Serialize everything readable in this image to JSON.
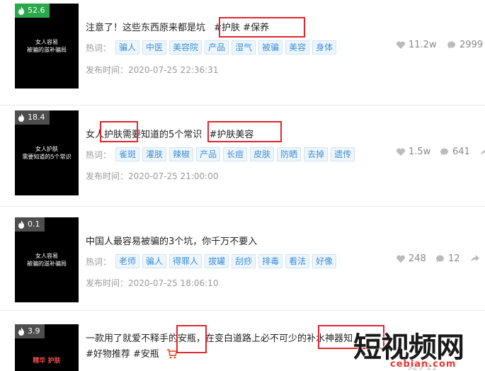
{
  "labels": {
    "hot_words": "热词："
  },
  "items": [
    {
      "heat": "52.6",
      "thumb_text": "女人容易\n被骗的滋补骗局",
      "title": "注意了！这些东西原来都是坑",
      "hashtags": "#护肤 #保养",
      "tags": [
        "骗人",
        "中医",
        "美容院",
        "产品",
        "湿气",
        "被骗",
        "美容",
        "身体"
      ],
      "time": "发布时间：2020-07-25 22:36:31",
      "likes": "11.2w",
      "comments": "2999"
    },
    {
      "heat": "18.4",
      "thumb_text": "女人护肤\n需要知道的5个常识",
      "title_a": "女人",
      "title_b": "护肤",
      "title_c": "需要知道的5个常识",
      "hashtags": "#护肤美容",
      "tags": [
        "雀斑",
        "灌肤",
        "辣椒",
        "产品",
        "长痘",
        "皮肤",
        "防晒",
        "去掉",
        "遗传"
      ],
      "time": "发布时间：2020-07-25 21:00:00",
      "likes": "1.5w",
      "comments": "641"
    },
    {
      "heat": "0.1",
      "thumb_text": "女人容易\n被骗的滋补骗局",
      "title": "中国人最容易被骗的3个坑，你千万不要入",
      "tags": [
        "老师",
        "骗人",
        "得罪人",
        "拔罐",
        "刮痧",
        "排毒",
        "看法",
        "好像"
      ],
      "time": "发布时间：2020-07-25 18:06:10",
      "likes": "248",
      "comments": "12"
    },
    {
      "heat": "3.9",
      "thumb_text": "精华 护肤",
      "title_a": "一款用了就爱不释手的",
      "title_b": "安瓶",
      "title_c": "，在变白道路上必不可少的",
      "title_d": "补水神器",
      "title_e": "知",
      "hashtags": "#好物推荐 #安瓶",
      "partial_stats": "929   11"
    }
  ],
  "watermark": {
    "big": "短视频网",
    "small": "cebian.com"
  },
  "colors": {
    "tag_text": "#3b8ed6",
    "tag_bg": "#eef6fd",
    "box": "#e0262e",
    "heat_green": "#2aa84a"
  }
}
